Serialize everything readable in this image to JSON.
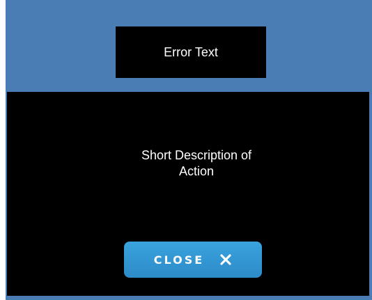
{
  "error_header": {
    "title": "Error Text"
  },
  "description": {
    "line1": "Short Description of",
    "line2": "Action"
  },
  "close_button": {
    "label": "CLOSE",
    "icon": "close-icon"
  },
  "colors": {
    "header_bg": "#4a7db3",
    "panel_bg": "#000000",
    "button_bg": "#3aa3dd",
    "text": "#ffffff"
  }
}
